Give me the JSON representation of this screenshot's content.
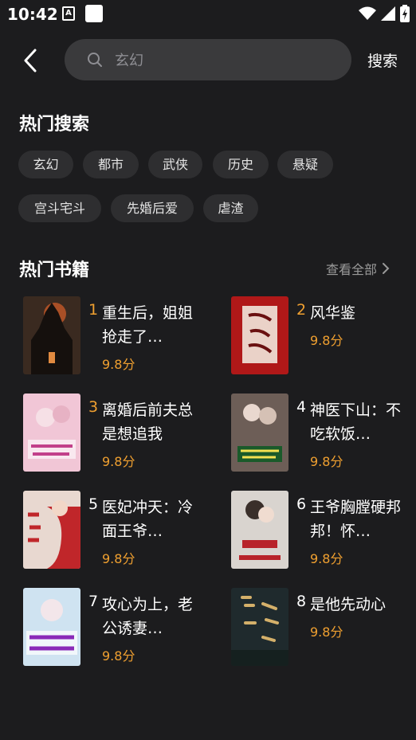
{
  "status": {
    "time": "10:42",
    "a_icon": "A"
  },
  "header": {
    "search_placeholder": "玄幻",
    "search_button": "搜索"
  },
  "hot_search": {
    "title": "热门搜索",
    "tags": [
      "玄幻",
      "都市",
      "武侠",
      "历史",
      "悬疑",
      "宫斗宅斗",
      "先婚后爱",
      "虐渣"
    ]
  },
  "hot_books": {
    "title": "热门书籍",
    "view_all": "查看全部",
    "items": [
      {
        "rank": "1",
        "title": "重生后，姐姐抢走了…",
        "score": "9.8分",
        "cover_color": "#3a2a20"
      },
      {
        "rank": "2",
        "title": "风华鉴",
        "score": "9.8分",
        "cover_color": "#b01818"
      },
      {
        "rank": "3",
        "title": "离婚后前夫总是想追我",
        "score": "9.8分",
        "cover_color": "#f1c6d6"
      },
      {
        "rank": "4",
        "title": "神医下山：不吃软饭…",
        "score": "9.8分",
        "cover_color": "#6d5e57"
      },
      {
        "rank": "5",
        "title": "医妃冲天：冷面王爷…",
        "score": "9.8分",
        "cover_color": "#e8d8d0"
      },
      {
        "rank": "6",
        "title": "王爷胸膛硬邦邦！怀…",
        "score": "9.8分",
        "cover_color": "#d9d4cf"
      },
      {
        "rank": "7",
        "title": "攻心为上，老公诱妻…",
        "score": "9.8分",
        "cover_color": "#cfe3f1"
      },
      {
        "rank": "8",
        "title": "是他先动心",
        "score": "9.8分",
        "cover_color": "#1f2a2d"
      }
    ]
  },
  "colors": {
    "background": "#1c1c1e",
    "accent": "#f0a030",
    "chip": "#2e2e30",
    "search_bg": "#3a3a3c"
  }
}
